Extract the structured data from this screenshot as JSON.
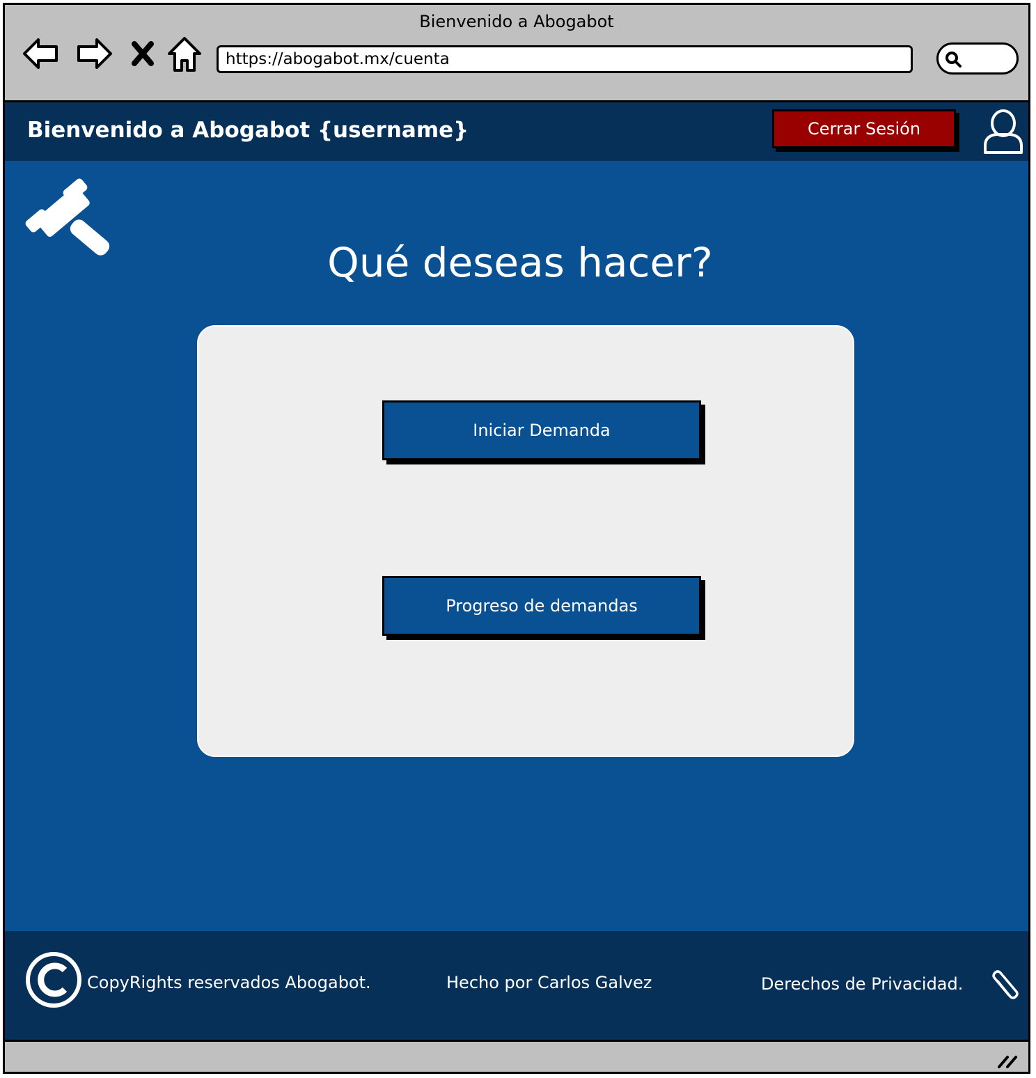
{
  "browser": {
    "window_title": "Bienvenido a Abogabot",
    "url": "https://abogabot.mx/cuenta",
    "nav_icons": [
      "back-arrow-icon",
      "forward-arrow-icon",
      "stop-icon",
      "home-icon"
    ],
    "search_icon": "search-icon"
  },
  "header": {
    "title": "Bienvenido a Abogabot {username}",
    "logout_label": "Cerrar Sesión",
    "user_icon": "user-icon"
  },
  "main": {
    "heading": "Qué deseas hacer?",
    "logo_icon": "gavel-icon",
    "actions": [
      {
        "label": "Iniciar Demanda"
      },
      {
        "label": "Progreso de demandas"
      }
    ]
  },
  "footer": {
    "copyright": "CopyRights reservados Abogabot.",
    "author": "Hecho por Carlos Galvez",
    "privacy": "Derechos de Privacidad.",
    "copyright_icon": "copyright-icon",
    "attachment_icon": "paperclip-icon"
  },
  "colors": {
    "header_bg": "#063058",
    "main_bg": "#095193",
    "logout_bg": "#990000",
    "card_bg": "#eeeeee",
    "chrome_bg": "#c0c0c0"
  }
}
